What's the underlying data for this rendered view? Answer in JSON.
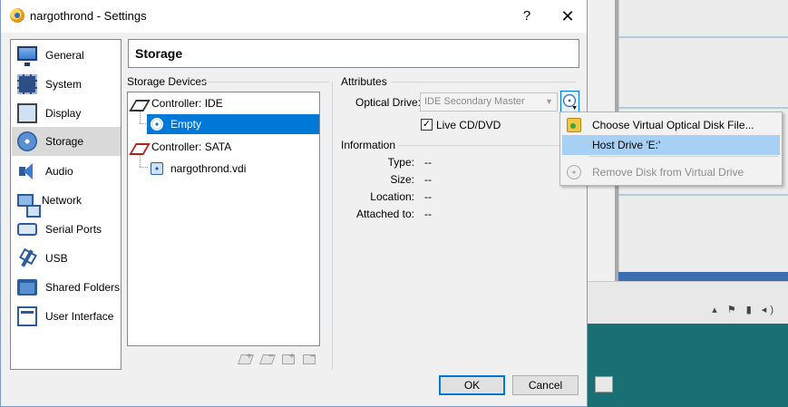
{
  "window": {
    "title": "nargothrond - Settings",
    "help_glyph": "?",
    "close_glyph": "✕"
  },
  "categories": [
    {
      "label": "General",
      "icon": "monitor-icon"
    },
    {
      "label": "System",
      "icon": "chip-icon"
    },
    {
      "label": "Display",
      "icon": "display-icon"
    },
    {
      "label": "Storage",
      "icon": "disk-icon",
      "selected": true
    },
    {
      "label": "Audio",
      "icon": "speaker-icon"
    },
    {
      "label": "Network",
      "icon": "network-icon"
    },
    {
      "label": "Serial Ports",
      "icon": "serial-port-icon"
    },
    {
      "label": "USB",
      "icon": "usb-icon"
    },
    {
      "label": "Shared Folders",
      "icon": "folder-icon"
    },
    {
      "label": "User Interface",
      "icon": "user-interface-icon"
    }
  ],
  "page_title": "Storage",
  "storage_devices": {
    "label": "Storage Devices",
    "tree": [
      {
        "label": "Controller: IDE",
        "type": "controller-ide"
      },
      {
        "label": "Empty",
        "type": "optical-empty",
        "selected": true
      },
      {
        "label": "Controller: SATA",
        "type": "controller-sata"
      },
      {
        "label": "nargothrond.vdi",
        "type": "hard-disk"
      }
    ],
    "toolbar": [
      "add-controller-icon",
      "remove-controller-icon",
      "add-attachment-icon",
      "remove-attachment-icon"
    ]
  },
  "attributes": {
    "label": "Attributes",
    "optical_drive_label": "Optical Drive:",
    "optical_drive_value": "IDE Secondary Master",
    "live_cd_label": "Live CD/DVD",
    "live_cd_checked": true
  },
  "information": {
    "label": "Information",
    "rows": [
      {
        "label": "Type:",
        "value": "--"
      },
      {
        "label": "Size:",
        "value": "--"
      },
      {
        "label": "Location:",
        "value": "--"
      },
      {
        "label": "Attached to:",
        "value": "--"
      }
    ]
  },
  "buttons": {
    "ok": "OK",
    "cancel": "Cancel"
  },
  "popup_menu": {
    "items": [
      {
        "label": "Choose Virtual Optical Disk File...",
        "icon": "choose-disk-file-icon"
      },
      {
        "label": "Host Drive 'E:'",
        "highlighted": true
      },
      {
        "label": "Remove Disk from Virtual Drive",
        "icon": "remove-disk-icon",
        "disabled": true
      }
    ]
  },
  "colors": {
    "selection": "#0078d7",
    "menu_highlight": "#a8d0f4",
    "desktop": "#1a6f73"
  }
}
